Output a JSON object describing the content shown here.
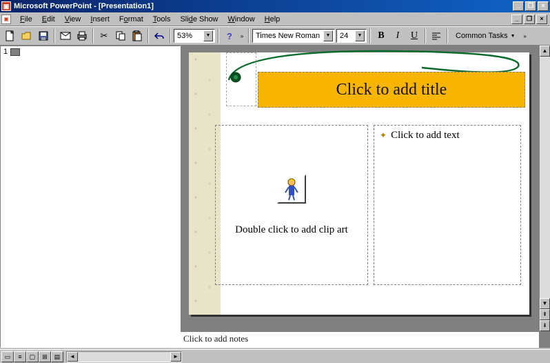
{
  "title": "Microsoft PowerPoint - [Presentation1]",
  "menus": {
    "file": "File",
    "edit": "Edit",
    "view": "View",
    "insert": "Insert",
    "format": "Format",
    "tools": "Tools",
    "slideshow": "Slide Show",
    "window": "Window",
    "help": "Help"
  },
  "toolbar": {
    "zoom": "53%",
    "font": "Times New Roman",
    "size": "24",
    "bold": "B",
    "italic": "I",
    "underline": "U",
    "common_tasks": "Common Tasks"
  },
  "outline": {
    "slide_number": "1"
  },
  "slide": {
    "title_placeholder": "Click to add title",
    "text_placeholder": "Click to add text",
    "clipart_placeholder": "Double click to add clip art"
  },
  "notes": {
    "placeholder": "Click to add notes"
  }
}
